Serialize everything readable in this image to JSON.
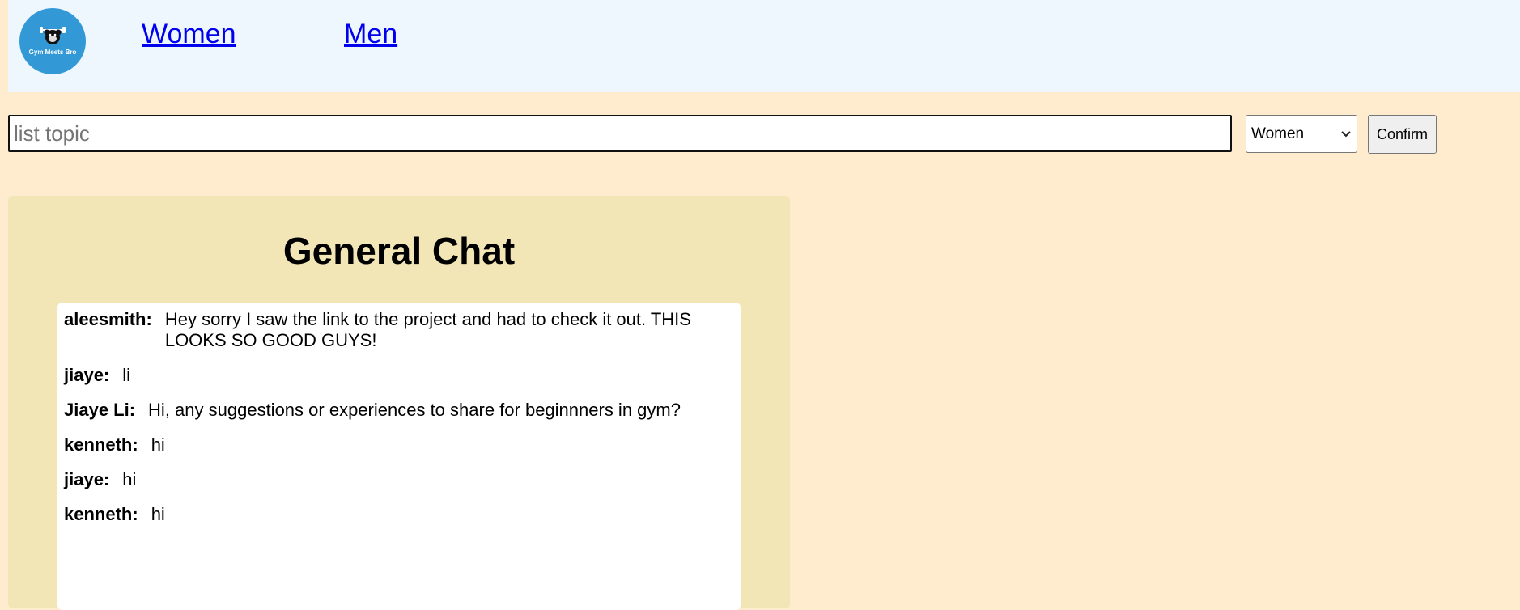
{
  "header": {
    "logo_text": "Gym Meets Bro",
    "nav": [
      {
        "label": "Women"
      },
      {
        "label": "Men"
      }
    ]
  },
  "topic_form": {
    "input_placeholder": "list topic",
    "input_value": "",
    "category_selected": "Women",
    "confirm_label": "Confirm"
  },
  "chat": {
    "title": "General Chat",
    "messages": [
      {
        "user": "aleesmith:",
        "text": "Hey sorry I saw the link to the project and had to check it out. THIS LOOKS SO GOOD GUYS!"
      },
      {
        "user": "jiaye:",
        "text": "li"
      },
      {
        "user": "Jiaye Li:",
        "text": "Hi, any suggestions or experiences to share for beginnners in gym?"
      },
      {
        "user": "kenneth:",
        "text": "hi"
      },
      {
        "user": "jiaye:",
        "text": "hi"
      },
      {
        "user": "kenneth:",
        "text": "hi"
      }
    ]
  },
  "colors": {
    "page_bg": "#FFEBCD",
    "header_bg": "#EEF6FE",
    "logo_bg": "#3399D6",
    "chat_panel_bg": "#F2E5B6",
    "chat_box_bg": "#FFFFFF",
    "link": "#0000EE"
  },
  "icons": {
    "logo": "gorilla-dumbbell-icon",
    "select": "chevron-down-icon"
  }
}
